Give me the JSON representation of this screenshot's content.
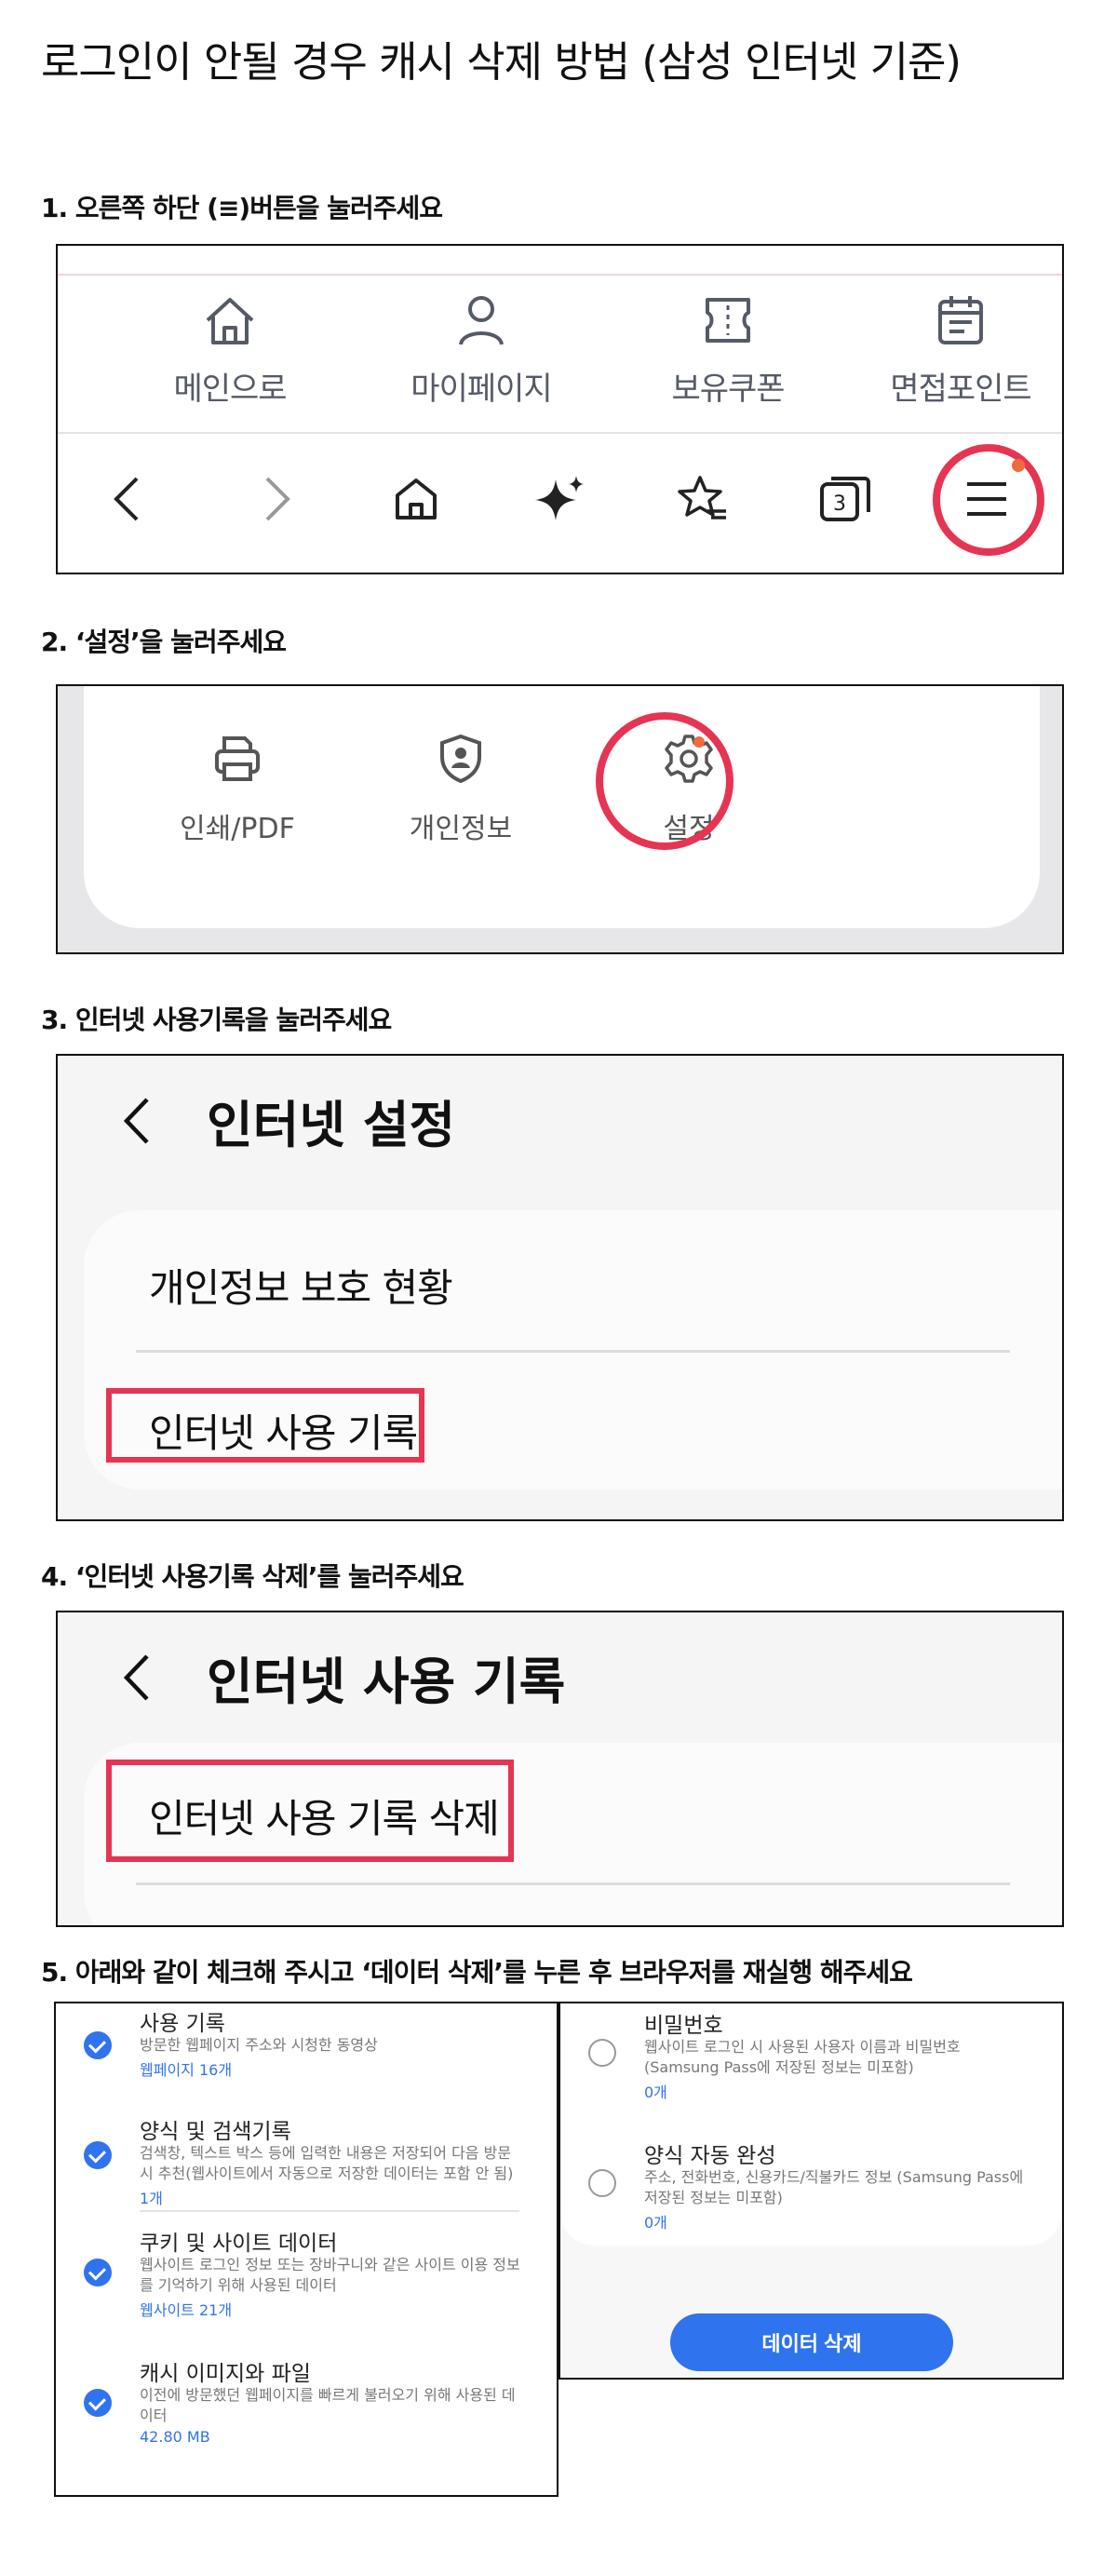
{
  "title": "로그인이 안될 경우 캐시 삭제 방법 (삼성 인터넷 기준)",
  "steps": [
    "1. 오른쪽 하단 (≡)버튼을 눌러주세요",
    "2. ‘설정’을 눌러주세요",
    "3. 인터넷 사용기록을 눌러주세요",
    "4. ‘인터넷 사용기록 삭제’를 눌러주세요",
    "5. 아래와 같이 체크해 주시고 ‘데이터 삭제’를 누른 후 브라우저를 재실행 해주세요"
  ],
  "step1": {
    "nav_items": [
      "메인으로",
      "마이페이지",
      "보유쿠폰",
      "면접포인트"
    ],
    "icons": [
      "home-icon",
      "person-icon",
      "ticket-icon",
      "calendar-icon"
    ],
    "toolbar_icons": [
      "back-icon",
      "forward-icon",
      "home-icon",
      "sparkle-icon",
      "star-list-icon",
      "tabs-icon",
      "menu-icon"
    ],
    "tab_count": "3"
  },
  "step2": {
    "items": [
      "인쇄/PDF",
      "개인정보",
      "설정"
    ],
    "icons": [
      "print-icon",
      "shield-person-icon",
      "gear-icon"
    ]
  },
  "step3": {
    "header": "인터넷 설정",
    "rows": [
      "개인정보 보호 현황",
      "인터넷 사용 기록"
    ]
  },
  "step4": {
    "header": "인터넷 사용 기록",
    "rows": [
      "인터넷 사용 기록 삭제"
    ]
  },
  "step5": {
    "left_options": [
      {
        "title": "사용 기록",
        "desc": "방문한 웹페이지 주소와 시청한 동영상",
        "count": "웹페이지 16개",
        "checked": true
      },
      {
        "title": "양식 및 검색기록",
        "desc": "검색창, 텍스트 박스 등에 입력한 내용은 저장되어 다음 방문 시 추천(웹사이트에서 자동으로 저장한 데이터는 포함 안 됨)",
        "count": "1개",
        "checked": true
      },
      {
        "title": "쿠키 및 사이트 데이터",
        "desc": "웹사이트 로그인 정보 또는 장바구니와 같은 사이트 이용 정보를 기억하기 위해 사용된 데이터",
        "count": "웹사이트 21개",
        "checked": true
      },
      {
        "title": "캐시 이미지와 파일",
        "desc": "이전에 방문했던 웹페이지를 빠르게 불러오기 위해 사용된 데이터",
        "count": "42.80 MB",
        "checked": true
      }
    ],
    "right_options": [
      {
        "title": "비밀번호",
        "desc": "웹사이트 로그인 시 사용된 사용자 이름과 비밀번호 (Samsung Pass에 저장된 정보는 미포함)",
        "count": "0개",
        "checked": false
      },
      {
        "title": "양식 자동 완성",
        "desc": "주소, 전화번호, 신용카드/직불카드 정보 (Samsung Pass에 저장된 정보는 미포함)",
        "count": "0개",
        "checked": false
      }
    ],
    "delete_button": "데이터 삭제"
  },
  "colors": {
    "highlight": "#e53552",
    "accent": "#2f73ee"
  }
}
